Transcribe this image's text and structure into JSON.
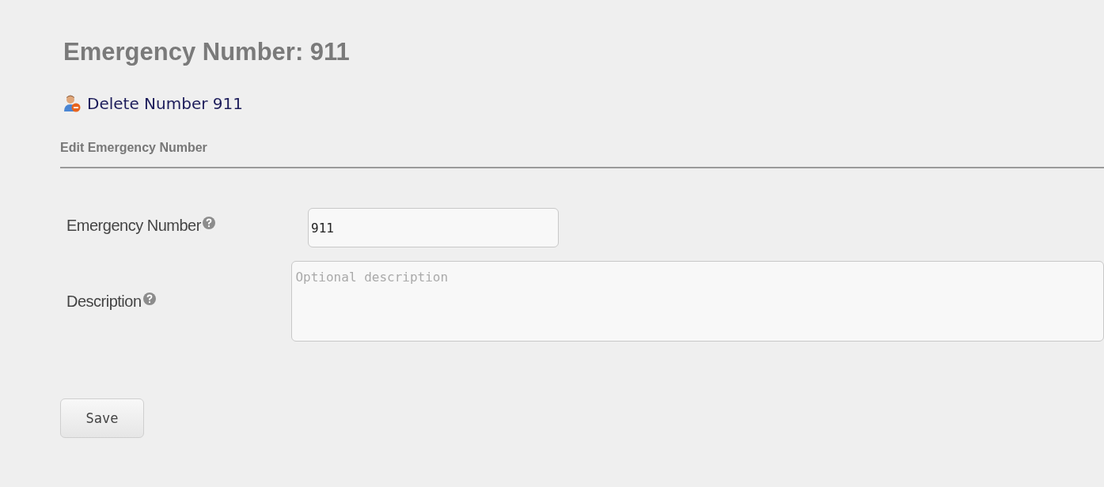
{
  "title": "Emergency Number: 911",
  "delete_link": {
    "label": "Delete Number 911"
  },
  "section": {
    "title": "Edit Emergency Number"
  },
  "fields": [
    {
      "label": "Emergency Number",
      "kind": "input",
      "value": "911"
    },
    {
      "label": "Description",
      "kind": "textarea",
      "placeholder": "Optional description"
    }
  ],
  "buttons": [
    {
      "label": "Save"
    }
  ]
}
